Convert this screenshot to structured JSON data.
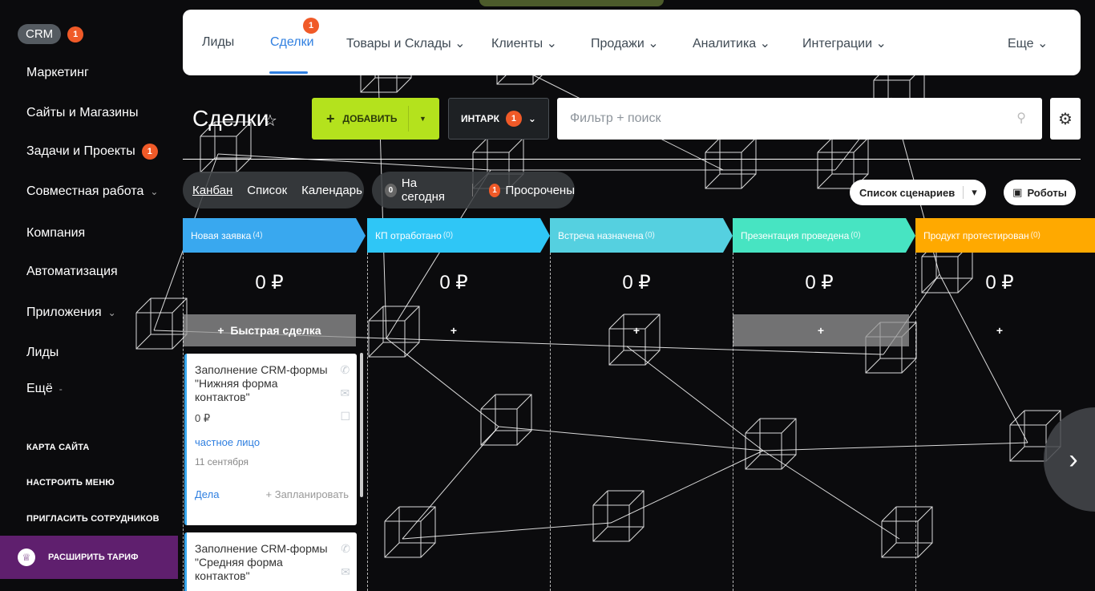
{
  "sidebar": {
    "crm_label": "CRM",
    "crm_badge": "1",
    "items": [
      {
        "label": "Маркетинг"
      },
      {
        "label": "Сайты и Магазины"
      },
      {
        "label": "Задачи и Проекты",
        "badge": "1"
      },
      {
        "label": "Совместная работа"
      },
      {
        "label": "Компания"
      },
      {
        "label": "Автоматизация"
      },
      {
        "label": "Приложения"
      },
      {
        "label": "Лиды"
      },
      {
        "label": "Ещё"
      }
    ],
    "links": [
      "КАРТА САЙТА",
      "НАСТРОИТЬ МЕНЮ",
      "ПРИГЛАСИТЬ СОТРУДНИКОВ"
    ],
    "upgrade_label": "РАСШИРИТЬ ТАРИФ"
  },
  "topnav": {
    "items": [
      "Лиды",
      "Сделки",
      "Товары и Склады",
      "Клиенты",
      "Продажи",
      "Аналитика",
      "Интеграции",
      "Еще"
    ],
    "active_badge": "1"
  },
  "toolbar": {
    "title": "Сделки",
    "add_label": "ДОБАВИТЬ",
    "intark_label": "ИНТАРК",
    "intark_badge": "1",
    "search_placeholder": "Фильтр + поиск"
  },
  "views": {
    "kanban": "Канбан",
    "list": "Список",
    "calendar": "Календарь"
  },
  "counters": {
    "today_count": "0",
    "today_label": "На сегодня",
    "overdue_count": "1",
    "overdue_label": "Просрочены"
  },
  "scenarios_label": "Список сценариев",
  "robots_label": "Роботы",
  "columns": [
    {
      "name": "Новая заявка",
      "count": "(4)",
      "sum": "0 ₽",
      "add_label": "Быстрая сделка",
      "color": "#39a8ef"
    },
    {
      "name": "КП отработано",
      "count": "(0)",
      "sum": "0 ₽",
      "color": "#2fc6f6"
    },
    {
      "name": "Встреча назначена",
      "count": "(0)",
      "sum": "0 ₽",
      "color": "#55d0e0"
    },
    {
      "name": "Презентация проведена",
      "count": "(0)",
      "sum": "0 ₽",
      "color": "#47e4c2"
    },
    {
      "name": "Продукт протестирован",
      "count": "(0)",
      "sum": "0 ₽",
      "color": "#ffa900"
    }
  ],
  "add_plus": "+",
  "deals": [
    {
      "title": "Заполнение CRM-формы \"Нижняя форма контактов\"",
      "sum": "0 ₽",
      "client": "частное лицо",
      "date": "11 сентября",
      "tasks_label": "Дела",
      "plan_label": "+ Запланировать"
    },
    {
      "title": "Заполнение CRM-формы \"Средняя форма контактов\""
    }
  ],
  "colors": {
    "accent_blue": "#2f7fe0",
    "badge_red": "#f05a28",
    "add_green": "#b4e21d",
    "upgrade_purple": "#5f1f6e"
  }
}
